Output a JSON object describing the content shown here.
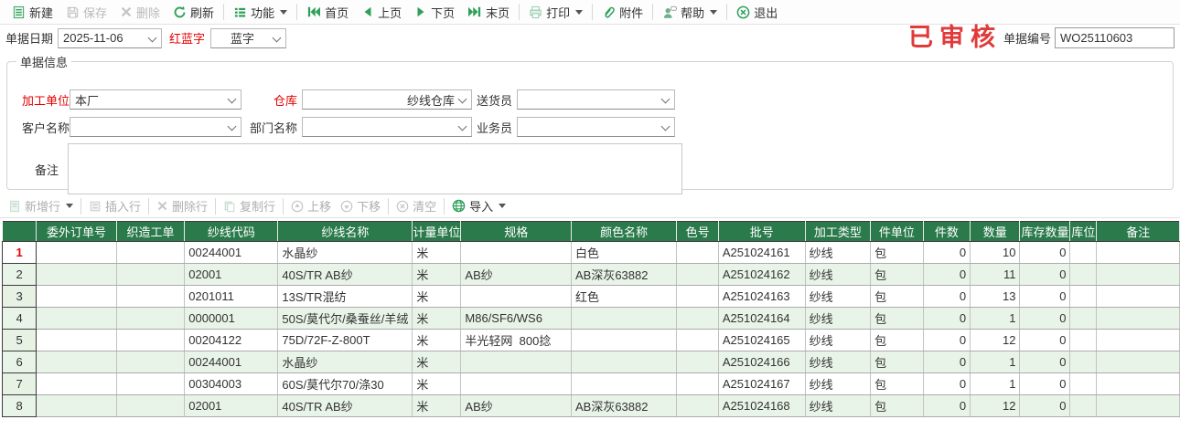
{
  "toolbar": {
    "new": "新建",
    "save": "保存",
    "delete": "删除",
    "refresh": "刷新",
    "functions": "功能",
    "first": "首页",
    "prev": "上页",
    "next": "下页",
    "last": "末页",
    "print": "打印",
    "attachments": "附件",
    "help": "帮助",
    "exit": "退出"
  },
  "doc_header": {
    "date_label": "单据日期",
    "date_value": "2025-11-06",
    "red_blue_label": "红蓝字",
    "red_blue_value": "蓝字",
    "audit_stamp": "已审核",
    "doc_no_label": "单据编号",
    "doc_no_value": "WO25110603"
  },
  "doc_info": {
    "legend": "单据信息",
    "processing_unit_label": "加工单位",
    "processing_unit_value": "本厂",
    "warehouse_label": "仓库",
    "warehouse_value": "纱线仓库",
    "delivery_person_label": "送货员",
    "delivery_person_value": "",
    "customer_label": "客户名称",
    "customer_value": "",
    "department_label": "部门名称",
    "department_value": "",
    "salesman_label": "业务员",
    "salesman_value": "",
    "remarks_label": "备注",
    "remarks_value": ""
  },
  "grid_toolbar": {
    "add_row": "新增行",
    "insert_row": "插入行",
    "delete_row": "删除行",
    "copy_row": "复制行",
    "move_up": "上移",
    "move_down": "下移",
    "clear": "清空",
    "import": "导入"
  },
  "table": {
    "columns": [
      "",
      "委外订单号",
      "织造工单",
      "纱线代码",
      "纱线名称",
      "计量单位",
      "规格",
      "颜色名称",
      "色号",
      "批号",
      "加工类型",
      "件单位",
      "件数",
      "数量",
      "库存数量",
      "库位",
      "备注"
    ],
    "selected_row": 1,
    "rows": [
      [
        "",
        "",
        "00244001",
        "水晶纱",
        "米",
        "",
        "白色",
        "",
        "A251024161",
        "纱线",
        "包",
        "0",
        "10",
        "0",
        "",
        ""
      ],
      [
        "",
        "",
        "02001",
        "40S/TR AB纱",
        "米",
        "AB纱",
        "AB深灰63882",
        "",
        "A251024162",
        "纱线",
        "包",
        "0",
        "11",
        "0",
        "",
        ""
      ],
      [
        "",
        "",
        "0201011",
        "13S/TR混纺",
        "米",
        "",
        "红色",
        "",
        "A251024163",
        "纱线",
        "包",
        "0",
        "13",
        "0",
        "",
        ""
      ],
      [
        "",
        "",
        "0000001",
        "50S/莫代尔/桑蚕丝/羊绒",
        "米",
        "M86/SF6/WS6",
        "",
        "",
        "A251024164",
        "纱线",
        "包",
        "0",
        "1",
        "0",
        "",
        ""
      ],
      [
        "",
        "",
        "00204122",
        "75D/72F-Z-800T",
        "米",
        "半光轻网  800捻",
        "",
        "",
        "A251024165",
        "纱线",
        "包",
        "0",
        "12",
        "0",
        "",
        ""
      ],
      [
        "",
        "",
        "00244001",
        "水晶纱",
        "米",
        "",
        "",
        "",
        "A251024166",
        "纱线",
        "包",
        "0",
        "1",
        "0",
        "",
        ""
      ],
      [
        "",
        "",
        "00304003",
        "60S/莫代尔70/涤30",
        "米",
        "",
        "",
        "",
        "A251024167",
        "纱线",
        "包",
        "0",
        "1",
        "0",
        "",
        ""
      ],
      [
        "",
        "",
        "02001",
        "40S/TR AB纱",
        "米",
        "AB纱",
        "AB深灰63882",
        "",
        "A251024168",
        "纱线",
        "包",
        "0",
        "12",
        "0",
        "",
        ""
      ]
    ]
  },
  "colors": {
    "header_green": "#2a7a4b",
    "icon_green": "#2fa05a",
    "row_green": "#e9f4e9",
    "label_red": "#e60000",
    "stamp_red": "#e03a3a"
  }
}
